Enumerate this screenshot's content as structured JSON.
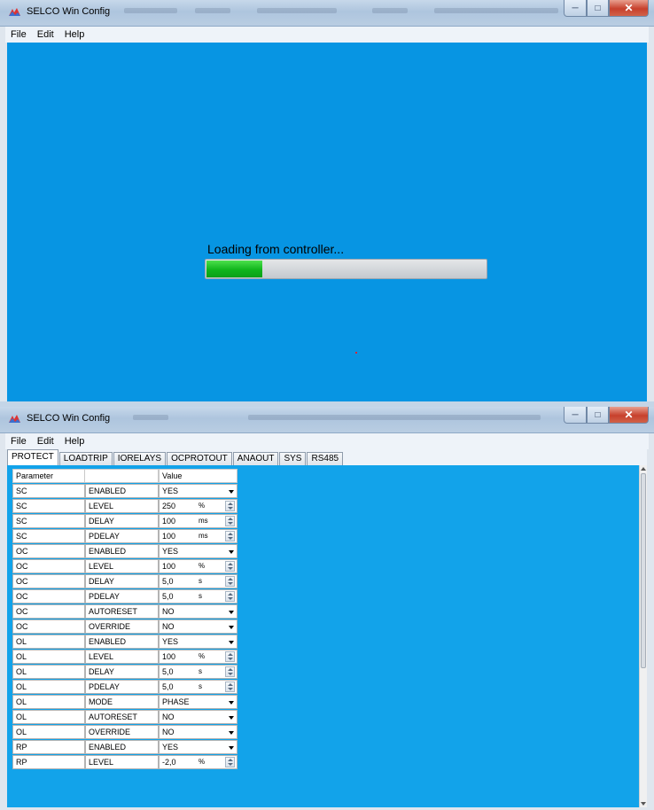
{
  "window1": {
    "title": "SELCO Win Config",
    "menu": [
      "File",
      "Edit",
      "Help"
    ],
    "loading_text": "Loading from controller...",
    "progress": 0.2
  },
  "window2": {
    "title": "SELCO Win Config",
    "menu": [
      "File",
      "Edit",
      "Help"
    ],
    "tabs": [
      "PROTECT",
      "LOADTRIP",
      "IORELAYS",
      "OCPROTOUT",
      "ANAOUT",
      "SYS",
      "RS485"
    ],
    "active_tab": "PROTECT",
    "headers": {
      "parameter": "Parameter",
      "value": "Value"
    },
    "rows": [
      {
        "group": "SC",
        "param": "ENABLED",
        "value": "YES",
        "unit": "",
        "control": "select"
      },
      {
        "group": "SC",
        "param": "LEVEL",
        "value": "250",
        "unit": "%",
        "control": "spin"
      },
      {
        "group": "SC",
        "param": "DELAY",
        "value": "100",
        "unit": "ms",
        "control": "spin"
      },
      {
        "group": "SC",
        "param": "PDELAY",
        "value": "100",
        "unit": "ms",
        "control": "spin"
      },
      {
        "group": "OC",
        "param": "ENABLED",
        "value": "YES",
        "unit": "",
        "control": "select"
      },
      {
        "group": "OC",
        "param": "LEVEL",
        "value": "100",
        "unit": "%",
        "control": "spin"
      },
      {
        "group": "OC",
        "param": "DELAY",
        "value": "5,0",
        "unit": "s",
        "control": "spin"
      },
      {
        "group": "OC",
        "param": "PDELAY",
        "value": "5,0",
        "unit": "s",
        "control": "spin"
      },
      {
        "group": "OC",
        "param": "AUTORESET",
        "value": "NO",
        "unit": "",
        "control": "select"
      },
      {
        "group": "OC",
        "param": "OVERRIDE",
        "value": "NO",
        "unit": "",
        "control": "select"
      },
      {
        "group": "OL",
        "param": "ENABLED",
        "value": "YES",
        "unit": "",
        "control": "select"
      },
      {
        "group": "OL",
        "param": "LEVEL",
        "value": "100",
        "unit": "%",
        "control": "spin"
      },
      {
        "group": "OL",
        "param": "DELAY",
        "value": "5,0",
        "unit": "s",
        "control": "spin"
      },
      {
        "group": "OL",
        "param": "PDELAY",
        "value": "5,0",
        "unit": "s",
        "control": "spin"
      },
      {
        "group": "OL",
        "param": "MODE",
        "value": "PHASE",
        "unit": "",
        "control": "select"
      },
      {
        "group": "OL",
        "param": "AUTORESET",
        "value": "NO",
        "unit": "",
        "control": "select"
      },
      {
        "group": "OL",
        "param": "OVERRIDE",
        "value": "NO",
        "unit": "",
        "control": "select"
      },
      {
        "group": "RP",
        "param": "ENABLED",
        "value": "YES",
        "unit": "",
        "control": "select"
      },
      {
        "group": "RP",
        "param": "LEVEL",
        "value": "-2,0",
        "unit": "%",
        "control": "spin"
      }
    ]
  },
  "colors": {
    "client_bg_loading": "#0795e3",
    "client_bg_table": "#12a3ea",
    "progress_fill": "#10b51c"
  }
}
